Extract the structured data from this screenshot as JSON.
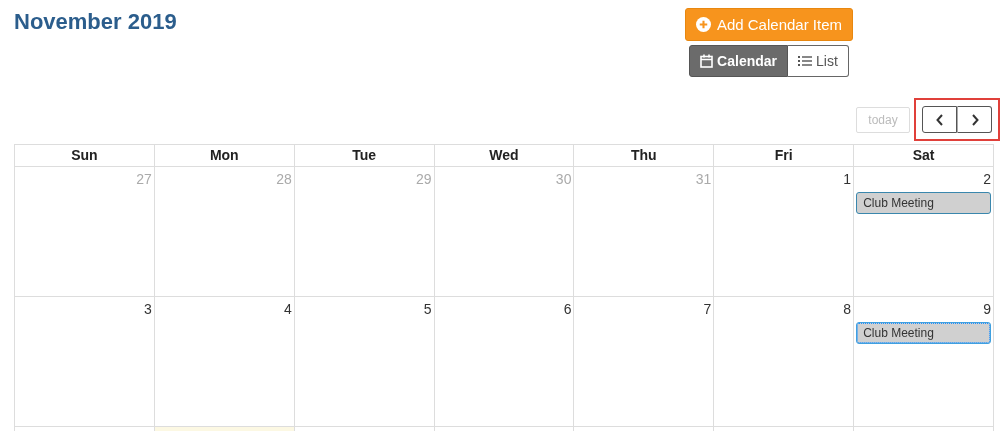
{
  "title": "November 2019",
  "add_button": {
    "label": "Add Calendar Item"
  },
  "view_toggle": [
    {
      "label": "Calendar",
      "selected": true,
      "kind": "calendar"
    },
    {
      "label": "List",
      "selected": false,
      "kind": "list"
    }
  ],
  "today_button": {
    "label": "today",
    "disabled": true
  },
  "nav": {
    "highlighted": true
  },
  "weekdays": [
    "Sun",
    "Mon",
    "Tue",
    "Wed",
    "Thu",
    "Fri",
    "Sat"
  ],
  "weeks": [
    {
      "days": [
        {
          "number": "27",
          "other_month": true,
          "today": false
        },
        {
          "number": "28",
          "other_month": true,
          "today": false
        },
        {
          "number": "29",
          "other_month": true,
          "today": false
        },
        {
          "number": "30",
          "other_month": true,
          "today": false
        },
        {
          "number": "31",
          "other_month": true,
          "today": false
        },
        {
          "number": "1",
          "other_month": false,
          "today": false
        },
        {
          "number": "2",
          "other_month": false,
          "today": false,
          "events": [
            {
              "title": "Club Meeting",
              "focused": false
            }
          ]
        }
      ]
    },
    {
      "days": [
        {
          "number": "3",
          "other_month": false,
          "today": false
        },
        {
          "number": "4",
          "other_month": false,
          "today": false
        },
        {
          "number": "5",
          "other_month": false,
          "today": false
        },
        {
          "number": "6",
          "other_month": false,
          "today": false
        },
        {
          "number": "7",
          "other_month": false,
          "today": false
        },
        {
          "number": "8",
          "other_month": false,
          "today": false
        },
        {
          "number": "9",
          "other_month": false,
          "today": false,
          "events": [
            {
              "title": "Club Meeting",
              "focused": true
            }
          ]
        }
      ]
    },
    {
      "days": [
        {
          "today": false
        },
        {
          "today": true
        },
        {
          "today": false
        },
        {
          "today": false
        },
        {
          "today": false
        },
        {
          "today": false
        },
        {
          "today": false
        }
      ]
    }
  ]
}
